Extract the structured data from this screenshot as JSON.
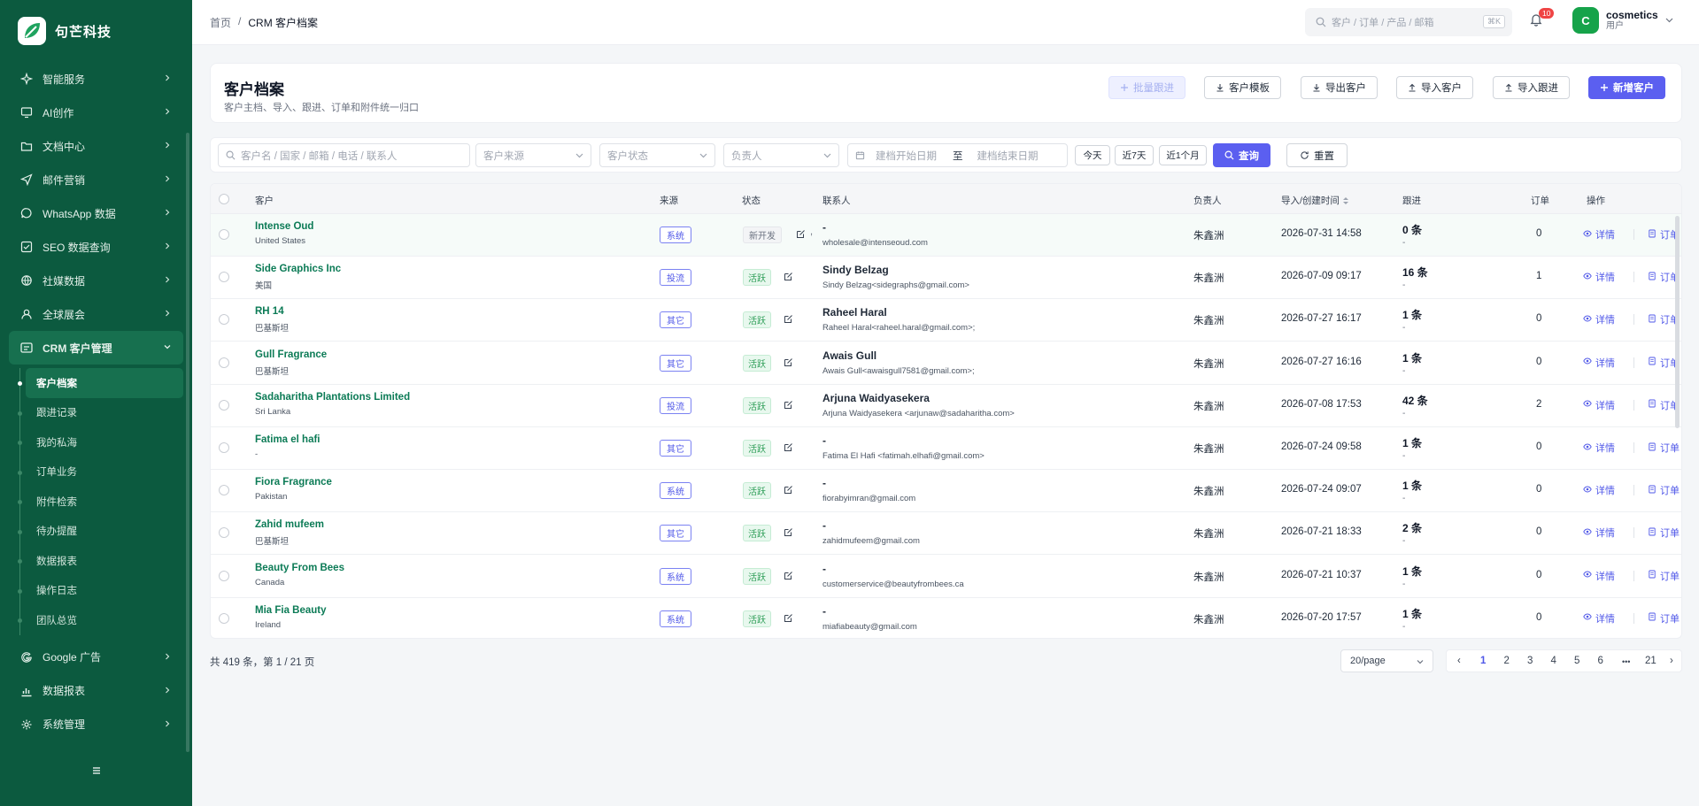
{
  "app": {
    "brand": "句芒科技"
  },
  "sidebar": {
    "items": [
      {
        "label": "智能服务",
        "icon": "spark-icon"
      },
      {
        "label": "AI创作",
        "icon": "monitor-icon"
      },
      {
        "label": "文档中心",
        "icon": "folder-icon"
      },
      {
        "label": "邮件营销",
        "icon": "send-icon"
      },
      {
        "label": "WhatsApp 数据",
        "icon": "chat-icon"
      },
      {
        "label": "SEO 数据查询",
        "icon": "check-square-icon"
      },
      {
        "label": "社媒数据",
        "icon": "social-icon"
      },
      {
        "label": "全球展会",
        "icon": "user-icon"
      }
    ],
    "crm": {
      "label": "CRM 客户管理"
    },
    "crm_sub": [
      "客户档案",
      "跟进记录",
      "我的私海",
      "订单业务",
      "附件检索",
      "待办提醒",
      "数据报表",
      "操作日志",
      "团队总览"
    ],
    "bottom_items": [
      {
        "label": "Google 广告",
        "icon": "google-icon"
      },
      {
        "label": "数据报表",
        "icon": "chart-icon"
      },
      {
        "label": "系统管理",
        "icon": "gear-icon"
      }
    ]
  },
  "header": {
    "breadcrumb_home": "首页",
    "breadcrumb_sep": "/",
    "breadcrumb_current": "CRM 客户档案",
    "search_placeholder": "客户 / 订单 / 产品 / 邮箱",
    "search_shortcut": "⌘K",
    "notifications": "10",
    "user_initial": "C",
    "user_name": "cosmetics",
    "user_role": "用户"
  },
  "page": {
    "title": "客户档案",
    "subtitle": "客户主档、导入、跟进、订单和附件统一归口",
    "buttons": {
      "bulk_follow": "批量跟进",
      "template": "客户模板",
      "export": "导出客户",
      "import_customers": "导入客户",
      "import_follow": "导入跟进",
      "new_customer": "新增客户"
    }
  },
  "filters": {
    "keyword_placeholder": "客户名 / 国家 / 邮箱 / 电话 / 联系人",
    "source_placeholder": "客户来源",
    "status_placeholder": "客户状态",
    "owner_placeholder": "负责人",
    "date_start": "建档开始日期",
    "date_sep": "至",
    "date_end": "建档结束日期",
    "today": "今天",
    "last7": "近7天",
    "last1m": "近1个月",
    "query": "查询",
    "reset": "重置"
  },
  "table": {
    "columns": {
      "customer": "客户",
      "source": "来源",
      "status": "状态",
      "contact": "联系人",
      "owner": "负责人",
      "created": "导入/创建时间",
      "follow": "跟进",
      "orders": "订单",
      "actions": "操作"
    },
    "action_detail": "详情",
    "action_order": "订单",
    "rows": [
      {
        "name": "Intense Oud",
        "country": "United States",
        "source": "系统",
        "status": "新开发",
        "contact": "-",
        "contact_sub": "wholesale@intenseoud.com",
        "owner": "朱鑫洲",
        "created": "2026-07-31 14:58",
        "follow": "0 条",
        "follow_sub": "-",
        "orders": "0",
        "extra": ","
      },
      {
        "name": "Side Graphics Inc",
        "country": "美国",
        "source": "投流",
        "status": "活跃",
        "contact": "Sindy Belzag",
        "contact_sub": "Sindy Belzag<sidegraphs@gmail.com>",
        "owner": "朱鑫洲",
        "created": "2026-07-09 09:17",
        "follow": "16 条",
        "follow_sub": "-",
        "orders": "1",
        "extra": ""
      },
      {
        "name": "RH 14",
        "country": "巴基斯坦",
        "source": "其它",
        "status": "活跃",
        "contact": "Raheel Haral",
        "contact_sub": "Raheel Haral<raheel.haral@gmail.com>;",
        "owner": "朱鑫洲",
        "created": "2026-07-27 16:17",
        "follow": "1 条",
        "follow_sub": "-",
        "orders": "0",
        "extra": ""
      },
      {
        "name": "Gull Fragrance",
        "country": "巴基斯坦",
        "source": "其它",
        "status": "活跃",
        "contact": "Awais Gull",
        "contact_sub": "Awais Gull<awaisgull7581@gmail.com>;",
        "owner": "朱鑫洲",
        "created": "2026-07-27 16:16",
        "follow": "1 条",
        "follow_sub": "-",
        "orders": "0",
        "extra": ""
      },
      {
        "name": "Sadaharitha Plantations Limited",
        "country": "Sri Lanka",
        "source": "投流",
        "status": "活跃",
        "contact": "Arjuna Waidyasekera",
        "contact_sub": "Arjuna Waidyasekera <arjunaw@sadaharitha.com>",
        "owner": "朱鑫洲",
        "created": "2026-07-08 17:53",
        "follow": "42 条",
        "follow_sub": "-",
        "orders": "2",
        "extra": ""
      },
      {
        "name": "Fatima el hafi",
        "country": "-",
        "source": "其它",
        "status": "活跃",
        "contact": "-",
        "contact_sub": "Fatima El Hafi <fatimah.elhafi@gmail.com>",
        "owner": "朱鑫洲",
        "created": "2026-07-24 09:58",
        "follow": "1 条",
        "follow_sub": "-",
        "orders": "0",
        "extra": ""
      },
      {
        "name": "Fiora Fragrance",
        "country": "Pakistan",
        "source": "系统",
        "status": "活跃",
        "contact": "-",
        "contact_sub": "fiorabyimran@gmail.com",
        "owner": "朱鑫洲",
        "created": "2026-07-24 09:07",
        "follow": "1 条",
        "follow_sub": "-",
        "orders": "0",
        "extra": ""
      },
      {
        "name": "Zahid mufeem",
        "country": "巴基斯坦",
        "source": "其它",
        "status": "活跃",
        "contact": "-",
        "contact_sub": "zahidmufeem@gmail.com",
        "owner": "朱鑫洲",
        "created": "2026-07-21 18:33",
        "follow": "2 条",
        "follow_sub": "-",
        "orders": "0",
        "extra": ""
      },
      {
        "name": "Beauty From Bees",
        "country": "Canada",
        "source": "系统",
        "status": "活跃",
        "contact": "-",
        "contact_sub": "customerservice@beautyfrombees.ca",
        "owner": "朱鑫洲",
        "created": "2026-07-21 10:37",
        "follow": "1 条",
        "follow_sub": "-",
        "orders": "0",
        "extra": ""
      },
      {
        "name": "Mia Fia Beauty",
        "country": "Ireland",
        "source": "系统",
        "status": "活跃",
        "contact": "-",
        "contact_sub": "miafiabeauty@gmail.com",
        "owner": "朱鑫洲",
        "created": "2026-07-20 17:57",
        "follow": "1 条",
        "follow_sub": "-",
        "orders": "0",
        "extra": ""
      }
    ]
  },
  "pagination": {
    "summary": "共 419 条，第 1 / 21 页",
    "page_size": "20/page",
    "prev": "‹",
    "pages": [
      "1",
      "2",
      "3",
      "4",
      "5",
      "6"
    ],
    "ellipsis": "•••",
    "last": "21",
    "next": "›",
    "current": "1"
  }
}
